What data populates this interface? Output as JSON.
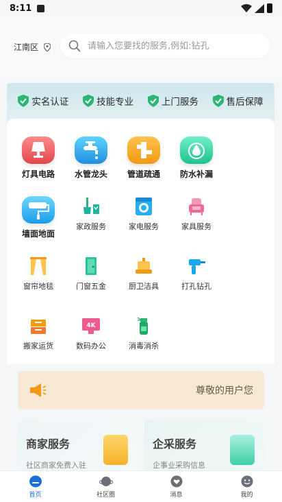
{
  "status_bar": {
    "time": "8:11"
  },
  "header": {
    "location": "江南区",
    "search_placeholder": "请输入您要找的服务,例如:钻孔"
  },
  "badges": [
    {
      "label": "实名认证"
    },
    {
      "label": "技能专业"
    },
    {
      "label": "上门服务"
    },
    {
      "label": "售后保障"
    }
  ],
  "categories": [
    {
      "label": "灯具电路",
      "icon": "lamp-icon"
    },
    {
      "label": "水管龙头",
      "icon": "faucet-icon"
    },
    {
      "label": "管道疏通",
      "icon": "pipe-icon"
    },
    {
      "label": "防水补漏",
      "icon": "waterdrop-icon"
    },
    {
      "label": "墙面地面",
      "icon": "paint-roller-icon"
    },
    {
      "label": "家政服务",
      "icon": "broom-icon"
    },
    {
      "label": "家电服务",
      "icon": "washing-machine-icon"
    },
    {
      "label": "家具服务",
      "icon": "sofa-icon"
    },
    {
      "label": "窗帘地毯",
      "icon": "curtain-icon"
    },
    {
      "label": "门窗五金",
      "icon": "door-icon"
    },
    {
      "label": "厨卫洁具",
      "icon": "kitchen-icon"
    },
    {
      "label": "打孔钻孔",
      "icon": "drill-icon"
    },
    {
      "label": "搬家运货",
      "icon": "moving-box-icon"
    },
    {
      "label": "数码办公",
      "icon": "4k-screen-icon"
    },
    {
      "label": "消毒消杀",
      "icon": "spray-bottle-icon"
    }
  ],
  "notice": {
    "text": "尊敬的用户您"
  },
  "services": [
    {
      "title": "商家服务",
      "subtitle": "社区商家免费入驻"
    },
    {
      "title": "企采服务",
      "subtitle": "企事业采购信息"
    }
  ],
  "tabs": [
    {
      "label": "首页"
    },
    {
      "label": "社区圈"
    },
    {
      "label": "消息"
    },
    {
      "label": "我的"
    }
  ],
  "colors": {
    "accent": "#1b6fd8",
    "badge_green": "#2bb673",
    "notice_bg": "#f7e9d6"
  }
}
